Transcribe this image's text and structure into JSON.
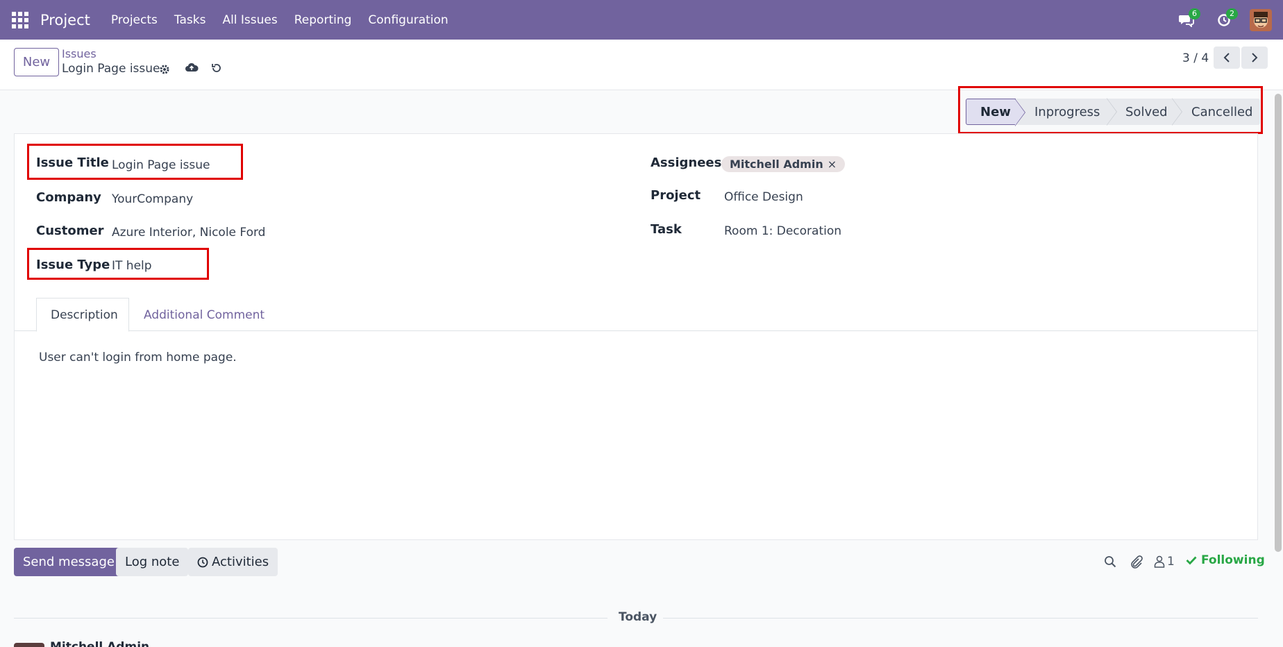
{
  "navbar": {
    "app_name": "Project",
    "menu": [
      "Projects",
      "Tasks",
      "All Issues",
      "Reporting",
      "Configuration"
    ],
    "messages_badge": "6",
    "activities_badge": "2"
  },
  "control_panel": {
    "new_label": "New",
    "breadcrumb_parent": "Issues",
    "breadcrumb_current": "Login Page issue",
    "pager": "3 / 4"
  },
  "statusbar": {
    "stages": [
      "New",
      "Inprogress",
      "Solved",
      "Cancelled"
    ],
    "active": "New"
  },
  "form": {
    "left": [
      {
        "label": "Issue Title",
        "value": "Login Page issue"
      },
      {
        "label": "Company",
        "value": "YourCompany"
      },
      {
        "label": "Customer",
        "value": "Azure Interior, Nicole Ford"
      },
      {
        "label": "Issue Type",
        "value": "IT help"
      }
    ],
    "right": [
      {
        "label": "Assignees",
        "value": "Mitchell Admin"
      },
      {
        "label": "Project",
        "value": "Office Design"
      },
      {
        "label": "Task",
        "value": "Room 1: Decoration"
      }
    ],
    "tag_remove": "×"
  },
  "tabs": [
    "Description",
    "Additional Comment"
  ],
  "description_text": "User can't login from home page.",
  "chatter": {
    "send_message": "Send message",
    "log_note": "Log note",
    "activities": "Activities",
    "followers_count": "1",
    "following": "Following",
    "today": "Today",
    "author": "Mitchell Admin"
  },
  "colors": {
    "brand": "#71639e",
    "highlight": "#e00000",
    "success": "#28a745"
  }
}
